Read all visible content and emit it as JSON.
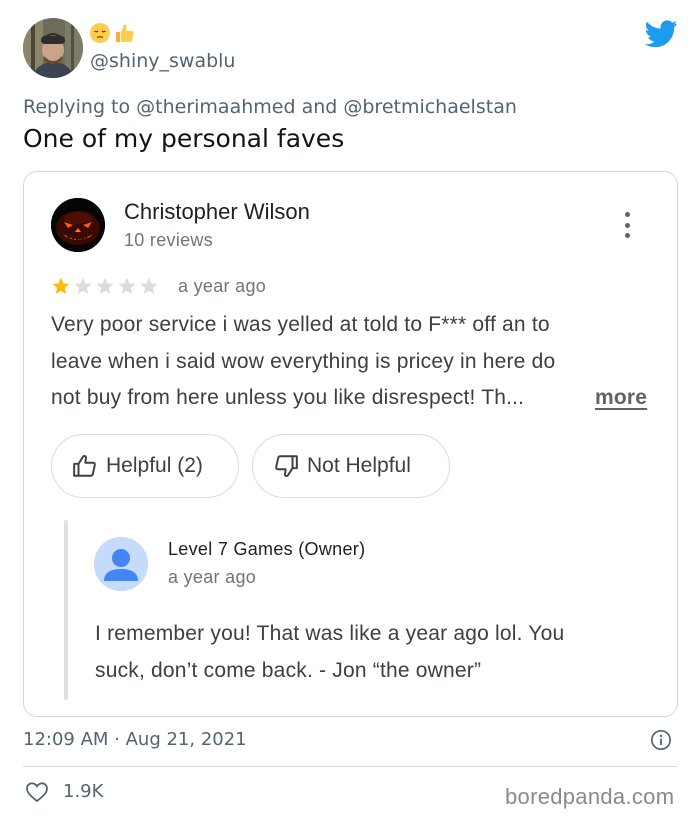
{
  "tweet": {
    "handle": "@shiny_swablu",
    "reply_prefix": "Replying to ",
    "mention_1": "@therimaahmed",
    "reply_and": " and ",
    "mention_2": "@bretmichaelstan",
    "text": "One of my personal faves",
    "timestamp": "12:09 AM · Aug 21, 2021",
    "likes": "1.9K",
    "display_name_emojis": [
      "pensive-face",
      "thumbs-up"
    ]
  },
  "review": {
    "reviewer_name": "Christopher Wilson",
    "reviewer_reviews": "10 reviews",
    "rating": 1,
    "rating_max": 5,
    "time": "a year ago",
    "text_lines": [
      "Very poor service i was yelled at told to F*** off an to",
      "leave when i said wow everything is pricey in here do",
      "not buy from here unless you like disrespect! Th..."
    ],
    "more_label": "more",
    "helpful_label": "Helpful (2)",
    "not_helpful_label": "Not Helpful"
  },
  "owner_reply": {
    "name": "Level 7 Games (Owner)",
    "time": "a year ago",
    "text_lines": [
      "I remember you! That was like a year ago lol. You",
      "suck, don’t come back. - Jon “the owner”"
    ]
  },
  "watermark": "boredpanda.com",
  "colors": {
    "twitter_blue": "#1d9bf0",
    "star_filled": "#fbbc04",
    "star_empty": "#dadce0",
    "owner_avatar_bg": "#c6dafc",
    "owner_avatar_fg": "#4285f4"
  }
}
